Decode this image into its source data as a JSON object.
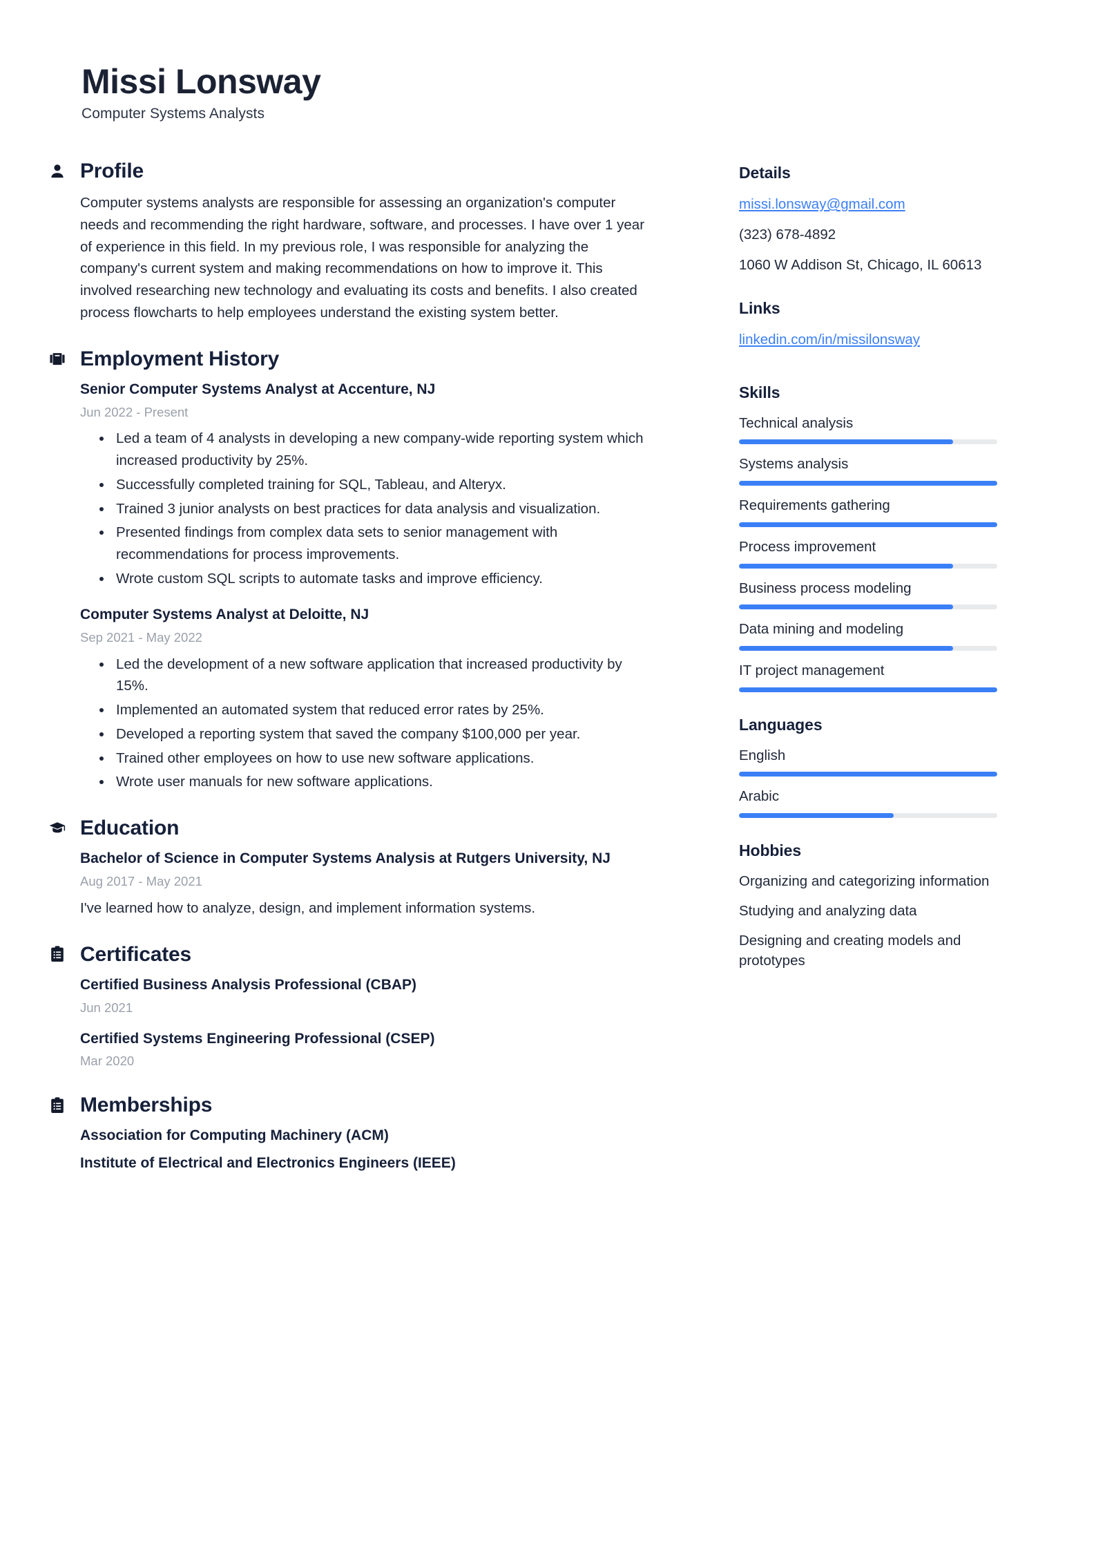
{
  "accent_color": "#3b7ff6",
  "text_color": "#1f2738",
  "muted_color": "#9aa0aa",
  "header": {
    "name": "Missi Lonsway",
    "job_title": "Computer Systems Analysts"
  },
  "main": {
    "profile": {
      "icon": "person-icon",
      "title": "Profile",
      "text": "Computer systems analysts are responsible for assessing an organization's computer needs and recommending the right hardware, software, and processes. I have over 1 year of experience in this field. In my previous role, I was responsible for analyzing the company's current system and making recommendations on how to improve it. This involved researching new technology and evaluating its costs and benefits. I also created process flowcharts to help employees understand the existing system better."
    },
    "employment": {
      "icon": "briefcase-icon",
      "title": "Employment History",
      "entries": [
        {
          "title": "Senior Computer Systems Analyst at Accenture, NJ",
          "date": "Jun 2022 - Present",
          "bullets": [
            "Led a team of 4 analysts in developing a new company-wide reporting system which increased productivity by 25%.",
            "Successfully completed training for SQL, Tableau, and Alteryx.",
            "Trained 3 junior analysts on best practices for data analysis and visualization.",
            "Presented findings from complex data sets to senior management with recommendations for process improvements.",
            "Wrote custom SQL scripts to automate tasks and improve efficiency."
          ]
        },
        {
          "title": "Computer Systems Analyst at Deloitte, NJ",
          "date": "Sep 2021 - May 2022",
          "bullets": [
            "Led the development of a new software application that increased productivity by 15%.",
            "Implemented an automated system that reduced error rates by 25%.",
            "Developed a reporting system that saved the company $100,000 per year.",
            "Trained other employees on how to use new software applications.",
            "Wrote user manuals for new software applications."
          ]
        }
      ]
    },
    "education": {
      "icon": "graduation-cap-icon",
      "title": "Education",
      "entries": [
        {
          "title": "Bachelor of Science in Computer Systems Analysis at Rutgers University, NJ",
          "date": "Aug 2017 - May 2021",
          "description": "I've learned how to analyze, design, and implement information systems."
        }
      ]
    },
    "certificates": {
      "icon": "clipboard-list-icon",
      "title": "Certificates",
      "entries": [
        {
          "title": "Certified Business Analysis Professional (CBAP)",
          "date": "Jun 2021"
        },
        {
          "title": "Certified Systems Engineering Professional (CSEP)",
          "date": "Mar 2020"
        }
      ]
    },
    "memberships": {
      "icon": "clipboard-list-icon",
      "title": "Memberships",
      "entries": [
        {
          "title": "Association for Computing Machinery (ACM)"
        },
        {
          "title": "Institute of Electrical and Electronics Engineers (IEEE)"
        }
      ]
    }
  },
  "sidebar": {
    "details": {
      "title": "Details",
      "email": "missi.lonsway@gmail.com",
      "phone": "(323) 678-4892",
      "address": "1060 W Addison St, Chicago, IL 60613"
    },
    "links": {
      "title": "Links",
      "items": [
        {
          "label": "linkedin.com/in/missilonsway"
        }
      ]
    },
    "skills": {
      "title": "Skills",
      "items": [
        {
          "label": "Technical analysis",
          "level": 83
        },
        {
          "label": "Systems analysis",
          "level": 100
        },
        {
          "label": "Requirements gathering",
          "level": 100
        },
        {
          "label": "Process improvement",
          "level": 83
        },
        {
          "label": "Business process modeling",
          "level": 83
        },
        {
          "label": "Data mining and modeling",
          "level": 83
        },
        {
          "label": "IT project management",
          "level": 100
        }
      ]
    },
    "languages": {
      "title": "Languages",
      "items": [
        {
          "label": "English",
          "level": 100
        },
        {
          "label": "Arabic",
          "level": 60
        }
      ]
    },
    "hobbies": {
      "title": "Hobbies",
      "items": [
        {
          "label": "Organizing and categorizing information"
        },
        {
          "label": "Studying and analyzing data"
        },
        {
          "label": "Designing and creating models and prototypes"
        }
      ]
    }
  }
}
